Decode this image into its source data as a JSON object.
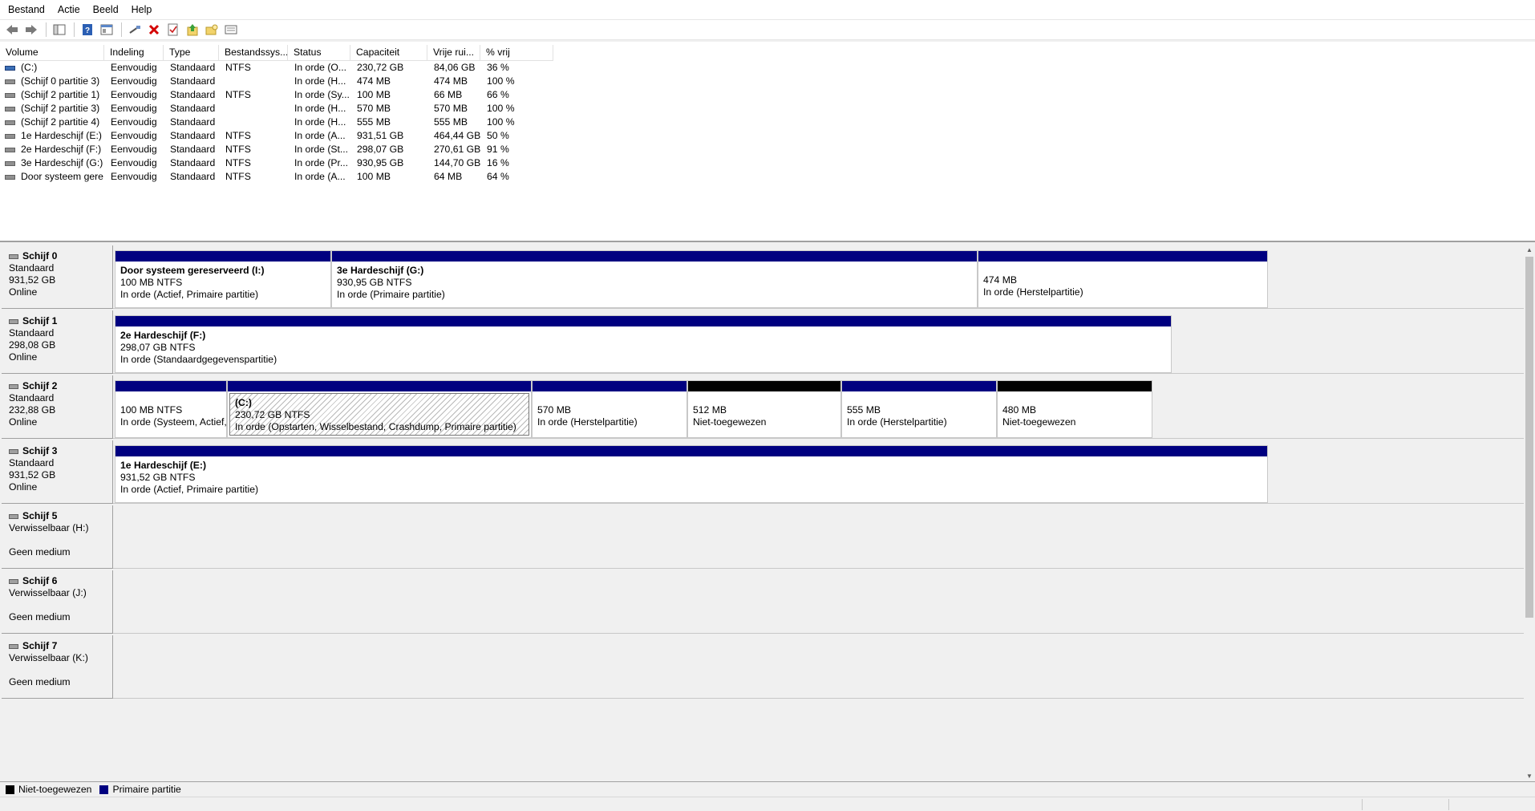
{
  "menu": [
    "Bestand",
    "Actie",
    "Beeld",
    "Help"
  ],
  "toolbar": [
    "back-icon",
    "forward-icon",
    "console-tree-icon",
    "help-icon",
    "properties-icon",
    "connect-icon",
    "delete-icon",
    "check-icon",
    "export-icon",
    "open-folder-icon",
    "view-icon"
  ],
  "columns": [
    "Volume",
    "Indeling",
    "Type",
    "Bestandssys...",
    "Status",
    "Capaciteit",
    "Vrije rui...",
    "% vrij"
  ],
  "volumes": [
    [
      "(C:)",
      "Eenvoudig",
      "Standaard",
      "NTFS",
      "In orde (O...",
      "230,72 GB",
      "84,06 GB",
      "36 %"
    ],
    [
      "(Schijf 0 partitie 3)",
      "Eenvoudig",
      "Standaard",
      "",
      "In orde (H...",
      "474 MB",
      "474 MB",
      "100 %"
    ],
    [
      "(Schijf 2 partitie 1)",
      "Eenvoudig",
      "Standaard",
      "NTFS",
      "In orde (Sy...",
      "100 MB",
      "66 MB",
      "66 %"
    ],
    [
      "(Schijf 2 partitie 3)",
      "Eenvoudig",
      "Standaard",
      "",
      "In orde (H...",
      "570 MB",
      "570 MB",
      "100 %"
    ],
    [
      "(Schijf 2 partitie 4)",
      "Eenvoudig",
      "Standaard",
      "",
      "In orde (H...",
      "555 MB",
      "555 MB",
      "100 %"
    ],
    [
      "1e Hardeschijf (E:)",
      "Eenvoudig",
      "Standaard",
      "NTFS",
      "In orde (A...",
      "931,51 GB",
      "464,44 GB",
      "50 %"
    ],
    [
      "2e Hardeschijf (F:)",
      "Eenvoudig",
      "Standaard",
      "NTFS",
      "In orde (St...",
      "298,07 GB",
      "270,61 GB",
      "91 %"
    ],
    [
      "3e Hardeschijf (G:)",
      "Eenvoudig",
      "Standaard",
      "NTFS",
      "In orde (Pr...",
      "930,95 GB",
      "144,70 GB",
      "16 %"
    ],
    [
      "Door systeem gere...",
      "Eenvoudig",
      "Standaard",
      "NTFS",
      "In orde (A...",
      "100 MB",
      "64 MB",
      "64 %"
    ]
  ],
  "disks": [
    {
      "name": "Schijf 0",
      "type": "Standaard",
      "size": "931,52 GB",
      "status": "Online",
      "partitions": [
        {
          "title": "Door systeem gereserveerd  (I:)",
          "size": "100 MB NTFS",
          "status": "In orde (Actief, Primaire partitie)",
          "kind": "primary"
        },
        {
          "title": "3e Hardeschijf  (G:)",
          "size": "930,95 GB NTFS",
          "status": "In orde (Primaire partitie)",
          "kind": "primary"
        },
        {
          "title": "",
          "size": "474 MB",
          "status": "In orde (Herstelpartitie)",
          "kind": "primary"
        }
      ]
    },
    {
      "name": "Schijf 1",
      "type": "Standaard",
      "size": "298,08 GB",
      "status": "Online",
      "partitions": [
        {
          "title": "2e Hardeschijf  (F:)",
          "size": "298,07 GB NTFS",
          "status": "In orde (Standaardgegevenspartitie)",
          "kind": "primary"
        }
      ]
    },
    {
      "name": "Schijf 2",
      "type": "Standaard",
      "size": "232,88 GB",
      "status": "Online",
      "partitions": [
        {
          "title": "",
          "size": "100 MB NTFS",
          "status": "In orde (Systeem, Actief, Prim",
          "kind": "primary"
        },
        {
          "title": "(C:)",
          "size": "230,72 GB NTFS",
          "status": "In orde (Opstarten, Wisselbestand, Crashdump, Primaire partitie)",
          "kind": "primary-selected"
        },
        {
          "title": "",
          "size": "570 MB",
          "status": "In orde (Herstelpartitie)",
          "kind": "primary"
        },
        {
          "title": "",
          "size": "512 MB",
          "status": "Niet-toegewezen",
          "kind": "unallocated"
        },
        {
          "title": "",
          "size": "555 MB",
          "status": "In orde (Herstelpartitie)",
          "kind": "primary"
        },
        {
          "title": "",
          "size": "480 MB",
          "status": "Niet-toegewezen",
          "kind": "unallocated"
        }
      ]
    },
    {
      "name": "Schijf 3",
      "type": "Standaard",
      "size": "931,52 GB",
      "status": "Online",
      "partitions": [
        {
          "title": "1e Hardeschijf  (E:)",
          "size": "931,52 GB NTFS",
          "status": "In orde (Actief, Primaire partitie)",
          "kind": "primary"
        }
      ]
    },
    {
      "name": "Schijf 5",
      "type": "Verwisselbaar (H:)",
      "size": "",
      "status": "Geen medium",
      "partitions": []
    },
    {
      "name": "Schijf 6",
      "type": "Verwisselbaar (J:)",
      "size": "",
      "status": "Geen medium",
      "partitions": []
    },
    {
      "name": "Schijf 7",
      "type": "Verwisselbaar (K:)",
      "size": "",
      "status": "Geen medium",
      "partitions": []
    }
  ],
  "legend": [
    {
      "label": "Niet-toegewezen",
      "color": "#000000"
    },
    {
      "label": "Primaire partitie",
      "color": "#000080"
    }
  ]
}
